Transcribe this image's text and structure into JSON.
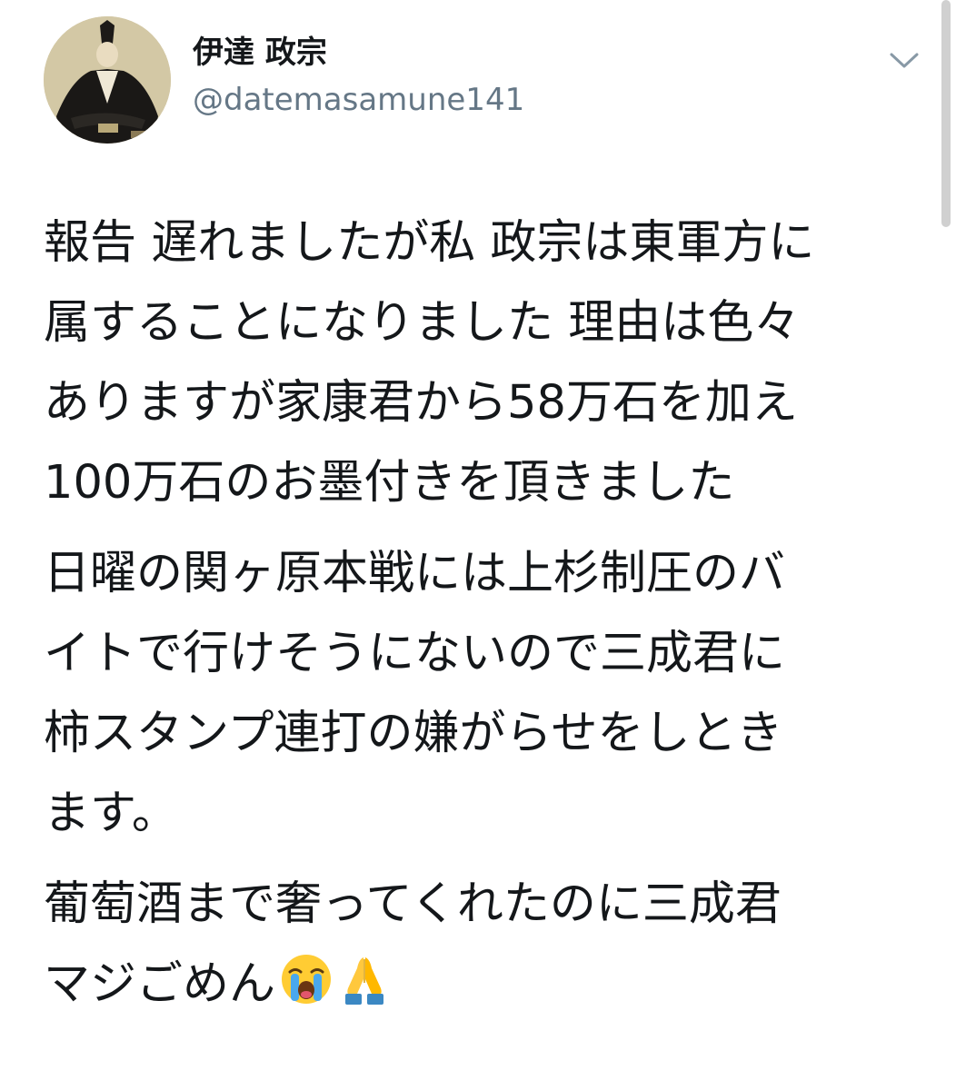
{
  "author": {
    "display_name": "伊達 政宗",
    "handle": "@datemasamune141",
    "avatar_icon": "samurai-portrait-avatar"
  },
  "menu": {
    "icon": "chevron-down-icon"
  },
  "tweet": {
    "paragraphs": [
      {
        "lines": [
          "報告 遅れましたが私 政宗は東軍方に",
          "属することになりました 理由は色々",
          "ありますが家康君から58万石を加え",
          "100万石のお墨付きを頂きました"
        ]
      },
      {
        "lines": [
          "日曜の関ヶ原本戦には上杉制圧のバ",
          "イトで行けそうにないので三成君に",
          "柿スタンプ連打の嫌がらせをしとき",
          "ます。"
        ]
      },
      {
        "lines": [
          "葡萄酒まで奢ってくれたのに三成君",
          "マジごめん"
        ],
        "emojis": [
          "loudly-crying-face-emoji",
          "folded-hands-emoji"
        ]
      }
    ]
  }
}
